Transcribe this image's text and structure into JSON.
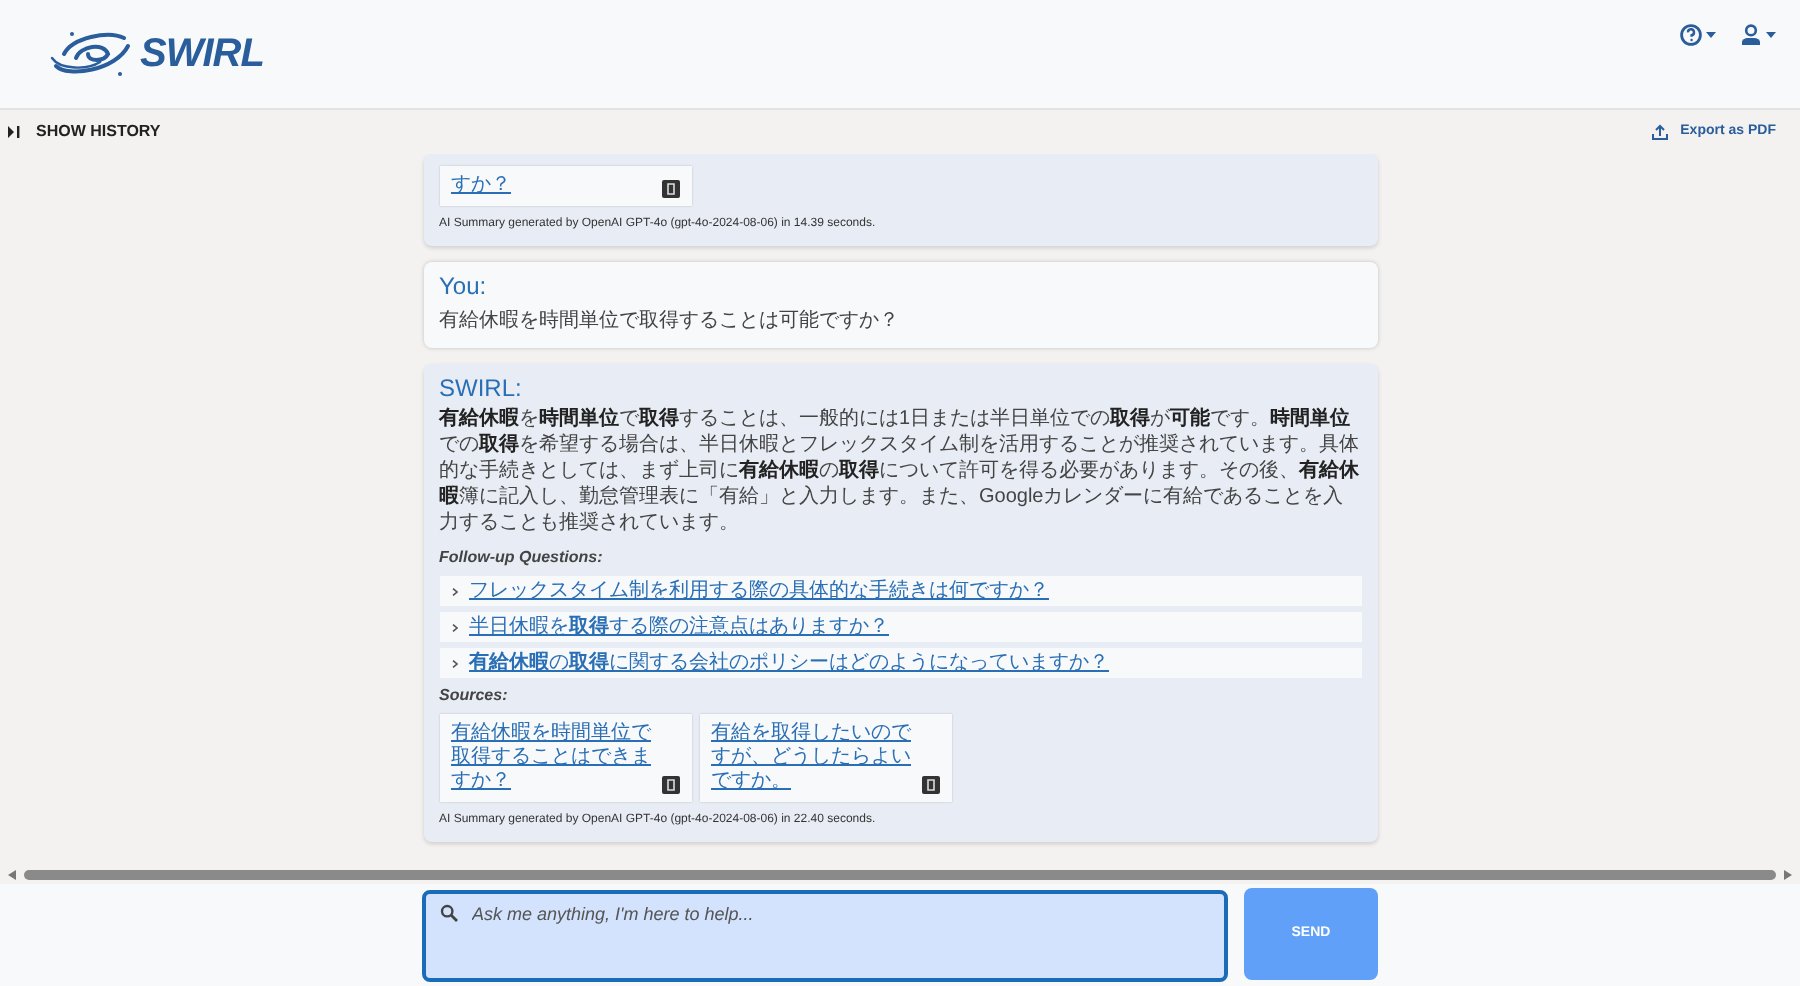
{
  "header": {
    "logo_text": "SWIRL"
  },
  "toolbar": {
    "show_history": "SHOW HISTORY",
    "export": "Export as PDF"
  },
  "conversation": [
    {
      "kind": "answer",
      "sources": [
        "すか？"
      ],
      "summary": "AI Summary generated by OpenAI GPT-4o (gpt-4o-2024-08-06) in 14.39 seconds."
    },
    {
      "kind": "question",
      "speaker": "You:",
      "text": "有給休暇を時間単位で取得することは可能ですか？"
    },
    {
      "kind": "answer",
      "speaker": "SWIRL:",
      "text": "**有給休暇**を**時間単位**で**取得**することは、一般的には1日または半日単位での**取得**が**可能**です。**時間単位**での**取得**を希望する場合は、半日休暇とフレックスタイム制を活用することが推奨されています。具体的な手続きとしては、まず上司に**有給休暇**の**取得**について許可を得る必要があります。その後、**有給休暇**簿に記入し、勤怠管理表に「有給」と入力します。また、Googleカレンダーに有給であることを入力することも推奨されています。",
      "follow_up_label": "Follow-up Questions:",
      "follow_ups": [
        "フレックスタイム制を利用する際の具体的な手続きは何ですか？",
        "半日休暇を**取得**する際の注意点はありますか？",
        "**有給休暇**の**取得**に関する会社のポリシーはどのようになっていますか？"
      ],
      "sources_label": "Sources:",
      "sources": [
        "有給休暇を時間単位で取得することはできますか？",
        "有給を取得したいのですが、どうしたらよいですか。"
      ],
      "summary": "AI Summary generated by OpenAI GPT-4o (gpt-4o-2024-08-06) in 22.40 seconds."
    }
  ],
  "composer": {
    "placeholder": "Ask me anything, I'm here to help...",
    "send": "SEND"
  }
}
